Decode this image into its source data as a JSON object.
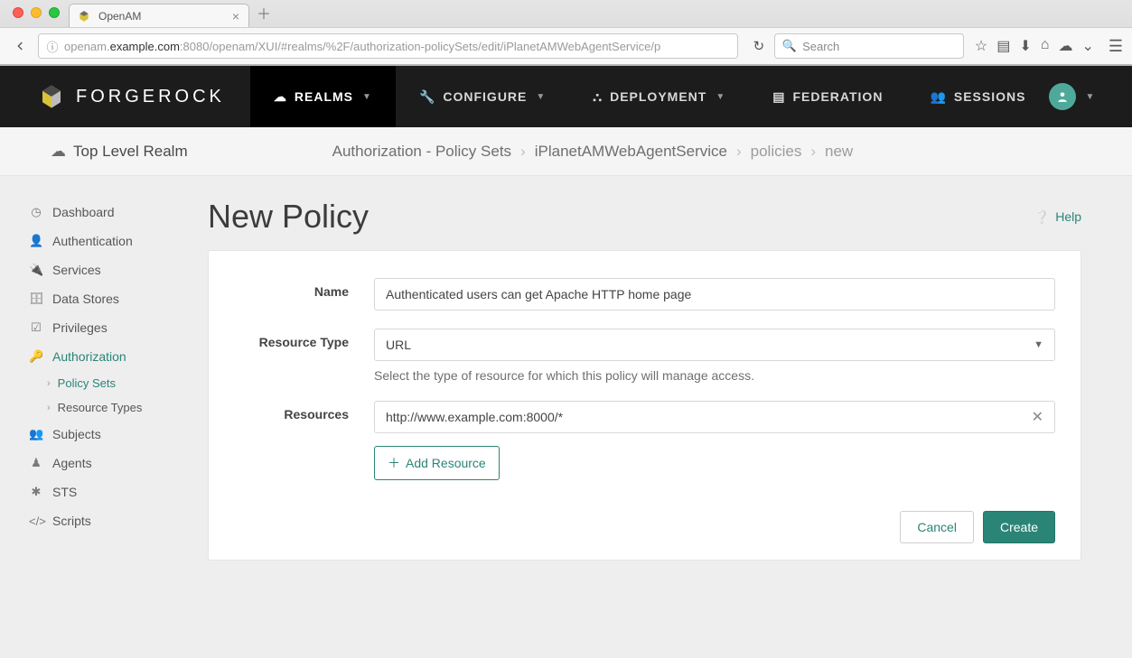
{
  "browser": {
    "tab_title": "OpenAM",
    "url_prefix": "openam.",
    "url_host": "example.com",
    "url_path": ":8080/openam/XUI/#realms/%2F/authorization-policySets/edit/iPlanetAMWebAgentService/p",
    "search_placeholder": "Search"
  },
  "brand": "FORGEROCK",
  "topnav": {
    "items": [
      {
        "label": "REALMS",
        "active": true,
        "caret": true
      },
      {
        "label": "CONFIGURE",
        "active": false,
        "caret": true
      },
      {
        "label": "DEPLOYMENT",
        "active": false,
        "caret": true
      },
      {
        "label": "FEDERATION",
        "active": false,
        "caret": false
      },
      {
        "label": "SESSIONS",
        "active": false,
        "caret": false
      }
    ]
  },
  "breadcrumb": {
    "realm": "Top Level Realm",
    "items": [
      "Authorization - Policy Sets",
      "iPlanetAMWebAgentService",
      "policies",
      "new"
    ]
  },
  "sidebar": {
    "items": [
      {
        "label": "Dashboard"
      },
      {
        "label": "Authentication"
      },
      {
        "label": "Services"
      },
      {
        "label": "Data Stores"
      },
      {
        "label": "Privileges"
      },
      {
        "label": "Authorization"
      },
      {
        "label": "Subjects"
      },
      {
        "label": "Agents"
      },
      {
        "label": "STS"
      },
      {
        "label": "Scripts"
      }
    ],
    "authorization_sub": [
      {
        "label": "Policy Sets",
        "active": true
      },
      {
        "label": "Resource Types",
        "active": false
      }
    ]
  },
  "page": {
    "title": "New Policy",
    "help": "Help"
  },
  "form": {
    "name_label": "Name",
    "name_value": "Authenticated users can get Apache HTTP home page",
    "resource_type_label": "Resource Type",
    "resource_type_value": "URL",
    "resource_type_help": "Select the type of resource for which this policy will manage access.",
    "resources_label": "Resources",
    "resources": [
      "http://www.example.com:8000/*"
    ],
    "add_resource": "Add Resource",
    "cancel": "Cancel",
    "create": "Create"
  }
}
